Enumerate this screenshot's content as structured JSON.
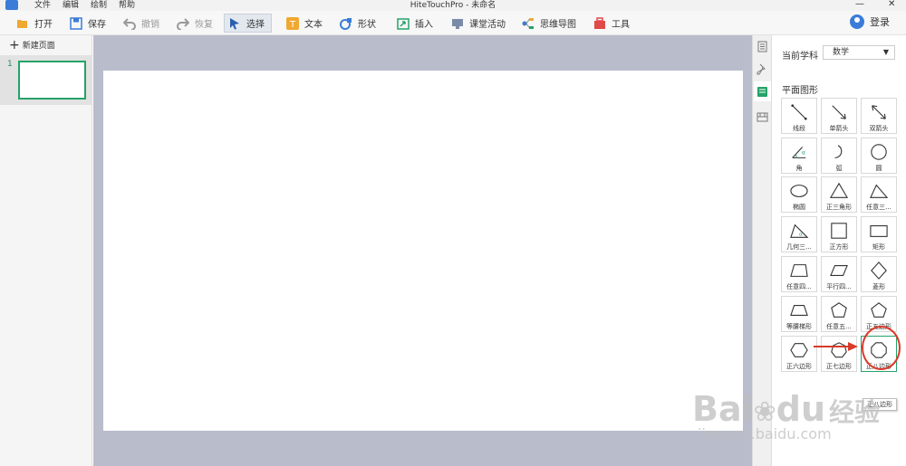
{
  "app": {
    "title": "HiteTouchPro - 未命名",
    "menu": [
      "文件",
      "编辑",
      "绘制",
      "帮助"
    ],
    "window_controls": [
      "minimize",
      "close"
    ]
  },
  "toolbar": {
    "open": "打开",
    "save": "保存",
    "undo": "撤销",
    "redo": "恢复",
    "select": "选择",
    "text": "文本",
    "shape": "形状",
    "insert": "插入",
    "activity": "课堂活动",
    "mindmap": "思维导图",
    "tools": "工具",
    "login": "登录"
  },
  "left_panel": {
    "new_page": "新建页面",
    "pages": [
      {
        "number": "1"
      }
    ]
  },
  "right_panel": {
    "subject_label": "当前学科",
    "subject_value": "数学",
    "section_title": "平面图形",
    "shapes": [
      {
        "label": "线段",
        "icon": "line-segment"
      },
      {
        "label": "单箭头",
        "icon": "single-arrow"
      },
      {
        "label": "双箭头",
        "icon": "double-arrow"
      },
      {
        "label": "角",
        "icon": "angle"
      },
      {
        "label": "弧",
        "icon": "arc"
      },
      {
        "label": "圆",
        "icon": "circle"
      },
      {
        "label": "椭圆",
        "icon": "ellipse"
      },
      {
        "label": "正三角形",
        "icon": "equilateral-triangle"
      },
      {
        "label": "任意三...",
        "icon": "triangle"
      },
      {
        "label": "几何三...",
        "icon": "geometry-triangle"
      },
      {
        "label": "正方形",
        "icon": "square"
      },
      {
        "label": "矩形",
        "icon": "rectangle"
      },
      {
        "label": "任意四...",
        "icon": "quadrilateral"
      },
      {
        "label": "平行四...",
        "icon": "parallelogram"
      },
      {
        "label": "菱形",
        "icon": "rhombus"
      },
      {
        "label": "等腰梯形",
        "icon": "isosceles-trapezoid"
      },
      {
        "label": "任意五...",
        "icon": "pentagon-free"
      },
      {
        "label": "正五边形",
        "icon": "regular-pentagon"
      },
      {
        "label": "正六边形",
        "icon": "regular-hexagon"
      },
      {
        "label": "正七边形",
        "icon": "regular-heptagon"
      },
      {
        "label": "正八边形",
        "icon": "regular-octagon"
      }
    ],
    "tooltip": "正八边形"
  },
  "watermark": {
    "brand": "Bai",
    "brand2": "du",
    "cn": "经验",
    "url": "jingyan.baidu.com"
  },
  "colors": {
    "accent_green": "#26a269",
    "canvas_bg": "#b9bccb",
    "annotation_red": "#d93a2b",
    "app_blue": "#3a7cd8"
  }
}
